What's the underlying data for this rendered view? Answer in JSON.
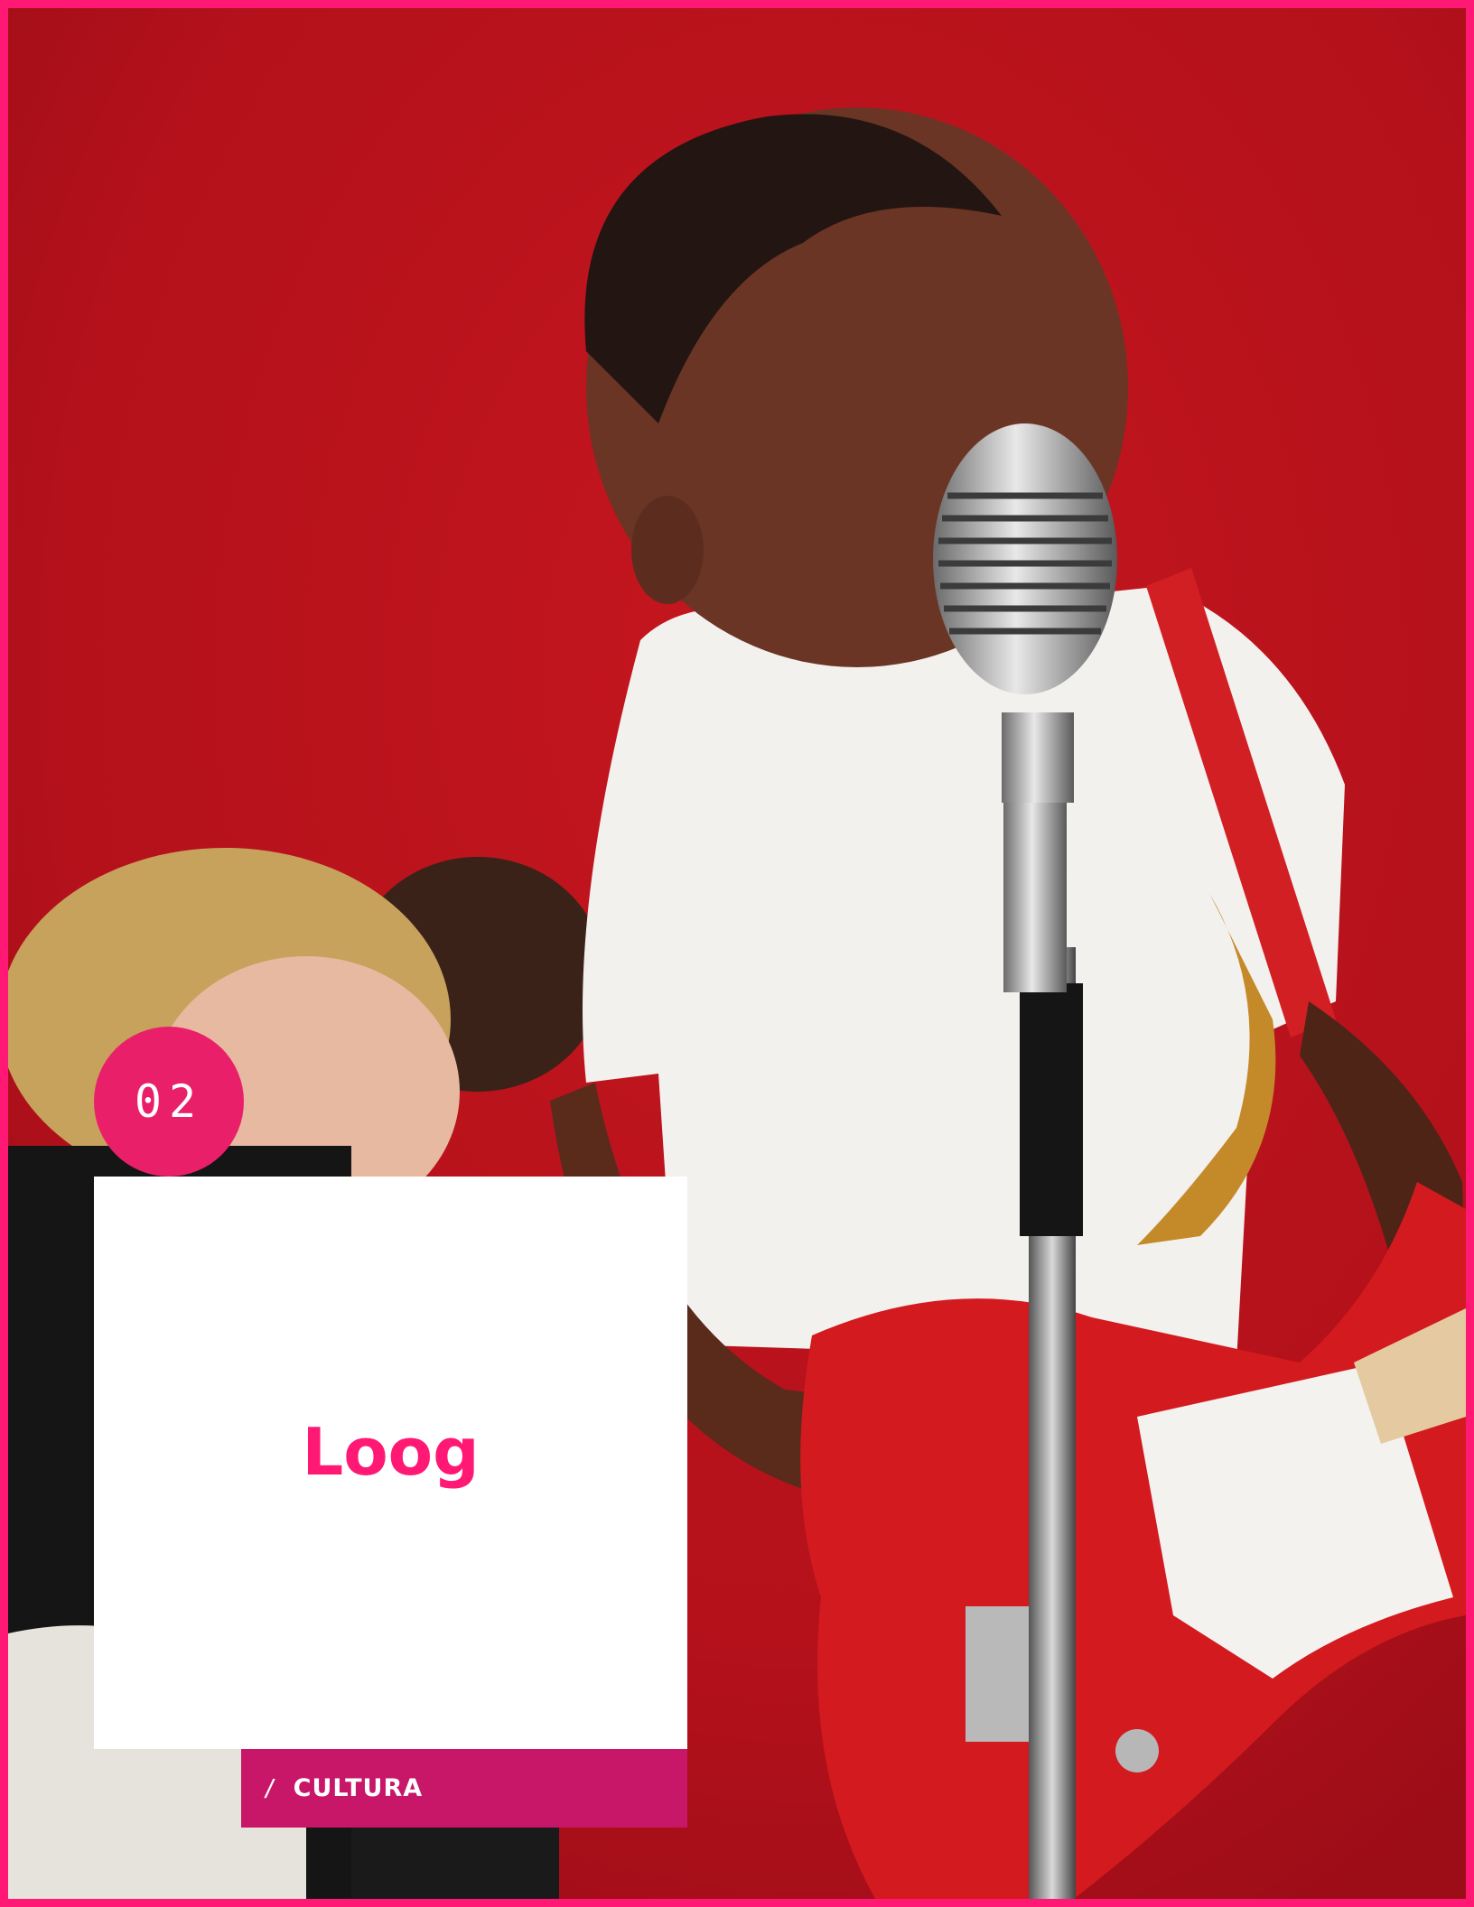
{
  "article": {
    "number": "02",
    "title": "Loog",
    "category_separator": "/",
    "category": "CULTURA"
  },
  "colors": {
    "frame": "#ff1874",
    "badge": "#ea1f6a",
    "title": "#ff1874",
    "category_bar": "#c81668",
    "background_red": "#b8121e"
  },
  "image": {
    "subject_icon": "kids-band-photo"
  }
}
